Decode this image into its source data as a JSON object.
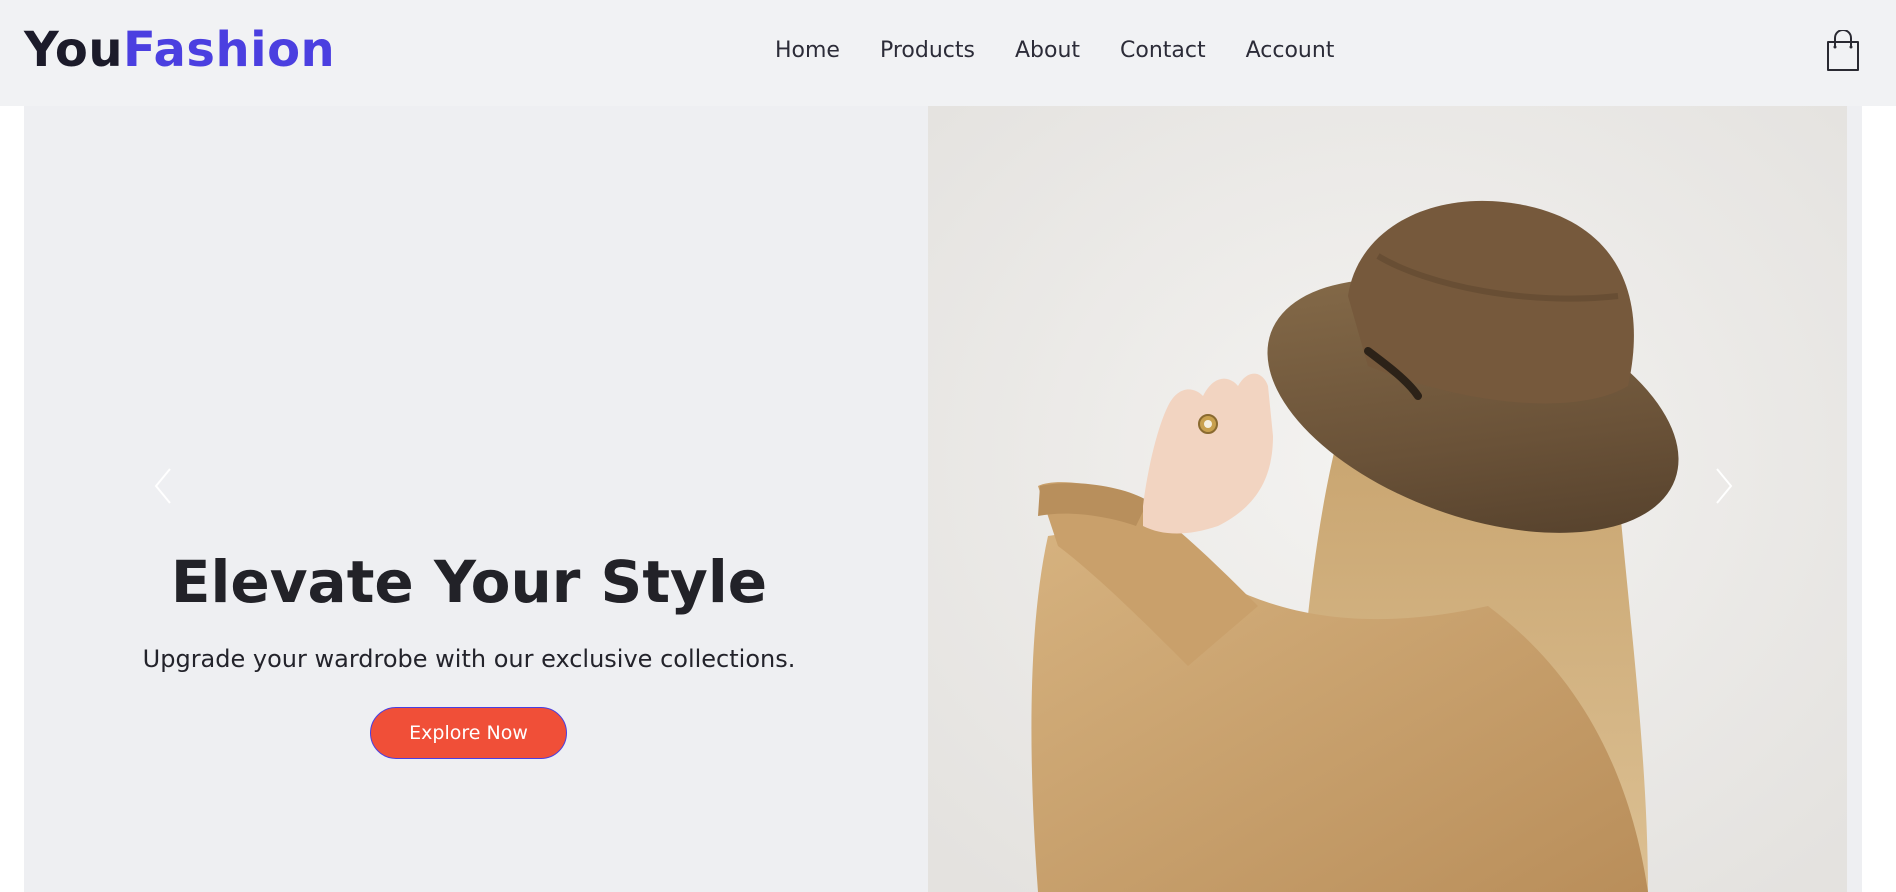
{
  "brand": {
    "part1": "You",
    "part2": "Fashion"
  },
  "nav": {
    "items": [
      {
        "label": "Home"
      },
      {
        "label": "Products"
      },
      {
        "label": "About"
      },
      {
        "label": "Contact"
      },
      {
        "label": "Account"
      }
    ]
  },
  "hero": {
    "headline": "Elevate Your Style",
    "subtext": "Upgrade your wardrobe with our exclusive collections.",
    "cta_label": "Explore Now"
  },
  "icons": {
    "cart": "shopping-bag-icon",
    "prev": "chevron-left-icon",
    "next": "chevron-right-icon"
  },
  "colors": {
    "brand_dark": "#1c1b2a",
    "brand_accent": "#4b3fe0",
    "cta_bg": "#f04f38",
    "navbar_bg": "#f1f2f4",
    "hero_bg": "#eeeff2"
  }
}
